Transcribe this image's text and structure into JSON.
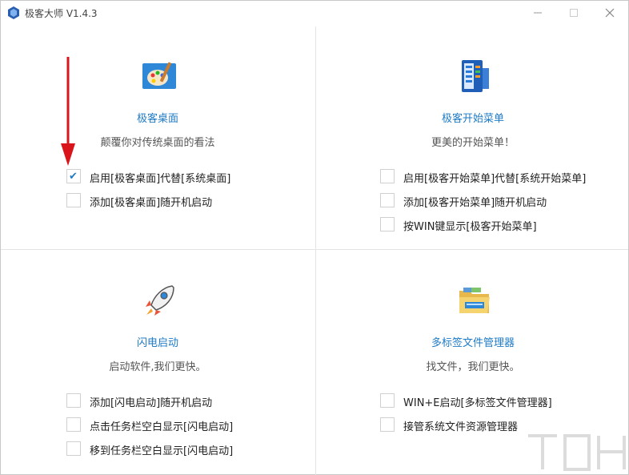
{
  "window": {
    "title": "极客大师 V1.4.3"
  },
  "panels": [
    {
      "icon": "palette-icon",
      "title": "极客桌面",
      "desc": "颠覆你对传统桌面的看法",
      "options": [
        {
          "label": "启用[极客桌面]代替[系统桌面]",
          "checked": true
        },
        {
          "label": "添加[极客桌面]随开机启动",
          "checked": false
        }
      ]
    },
    {
      "icon": "start-menu-icon",
      "title": "极客开始菜单",
      "desc": "更美的开始菜单！",
      "options": [
        {
          "label": "启用[极客开始菜单]代替[系统开始菜单]",
          "checked": false
        },
        {
          "label": "添加[极客开始菜单]随开机启动",
          "checked": false
        },
        {
          "label": "按WIN键显示[极客开始菜单]",
          "checked": false
        }
      ]
    },
    {
      "icon": "rocket-icon",
      "title": "闪电启动",
      "desc": "启动软件,我们更快。",
      "options": [
        {
          "label": "添加[闪电启动]随开机启动",
          "checked": false
        },
        {
          "label": "点击任务栏空白显示[闪电启动]",
          "checked": false
        },
        {
          "label": "移到任务栏空白显示[闪电启动]",
          "checked": false
        }
      ]
    },
    {
      "icon": "folder-icon",
      "title": "多标签文件管理器",
      "desc": "找文件，我们更快。",
      "options": [
        {
          "label": "WIN+E启动[多标签文件管理器]",
          "checked": false
        },
        {
          "label": "接管系统文件资源管理器",
          "checked": false
        }
      ]
    }
  ],
  "colors": {
    "accent": "#1e7bc6",
    "arrow": "#d9141b"
  }
}
